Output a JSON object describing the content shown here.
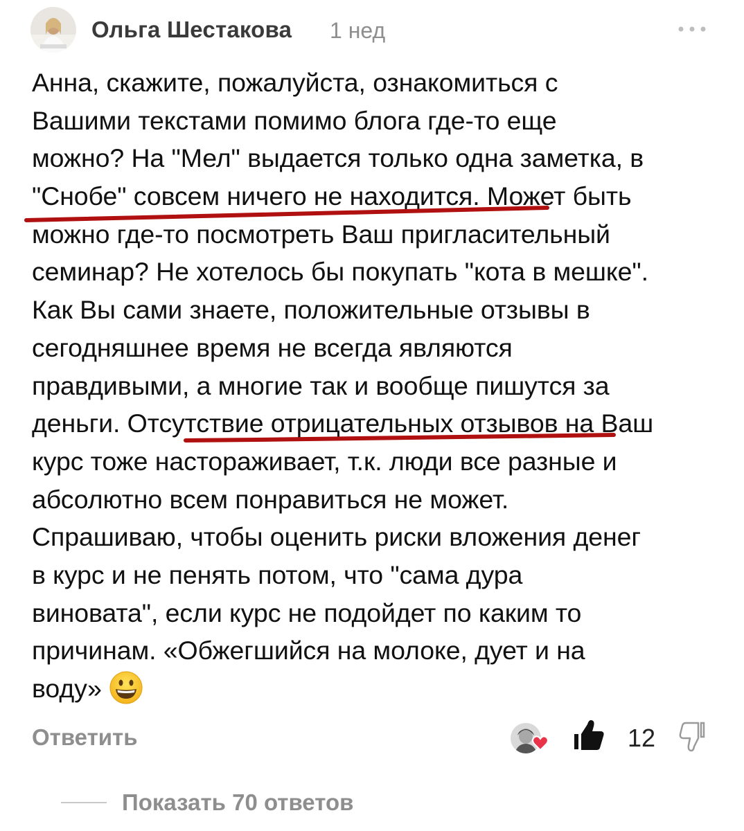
{
  "comment": {
    "author": "Ольга Шестакова",
    "time": "1 нед",
    "more_icon": "more-dots-icon",
    "lines": [
      "Анна, скажите, пожалуйста, ознакомиться с",
      "Вашими текстами помимо блога где-то еще",
      "можно? На \"Мел\" выдается только одна заметка, в",
      "\"Снобе\" совсем ничего не находится. Может быть",
      "можно где-то посмотреть Ваш пригласительный",
      "семинар? Не хотелось бы покупать \"кота в мешке\".",
      "Как Вы сами знаете, положительные отзывы в",
      "сегодняшнее время не всегда являются",
      "правдивыми, а многие так и вообще пишутся за",
      "деньги. Отсутствие отрицательных отзывов на Ваш",
      "курс тоже настораживает, т.к. люди все разные и",
      "абсолютно всем понравиться не может.",
      "Спрашиваю, чтобы оценить риски вложения денег",
      "в курс и не пенять потом, что \"сама дура",
      "виновата\", если курс не подойдет по каким то",
      "причинам. «Обжегшийся на молоке, дует и на",
      "воду»"
    ],
    "emoji": "grinning-face-emoji"
  },
  "actions": {
    "reply_label": "Ответить",
    "like_count": "12",
    "like_icon": "thumbs-up-icon",
    "dislike_icon": "thumbs-down-icon"
  },
  "replies": {
    "show_label": "Показать 70 ответов"
  },
  "colors": {
    "underline_marker": "#b01010",
    "muted_text": "#8e8e8e",
    "heart": "#e8334a"
  }
}
